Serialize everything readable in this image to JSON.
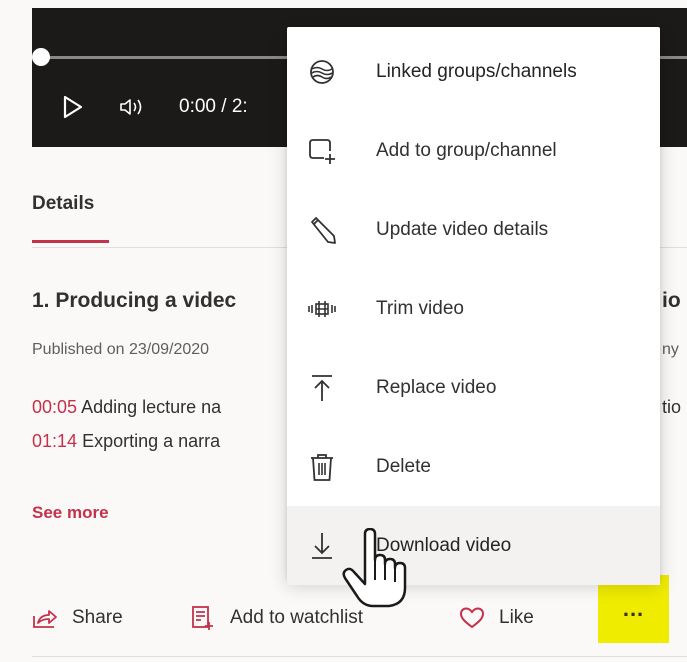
{
  "player": {
    "time": "0:00 / 2:"
  },
  "tabs": {
    "details": "Details"
  },
  "video": {
    "title": "1. Producing a videc",
    "title_tail": "io",
    "published": "Published on 23/09/2020",
    "published_tail": "ny",
    "chapters": [
      {
        "time": "00:05",
        "text": "Adding lecture na",
        "tail": "tio"
      },
      {
        "time": "01:14",
        "text": "Exporting a narra",
        "tail": ""
      }
    ],
    "see_more": "See more"
  },
  "actions": {
    "share": "Share",
    "watchlist": "Add to watchlist",
    "like": "Like",
    "more": "..."
  },
  "menu": {
    "items": [
      {
        "label": "Linked groups/channels",
        "icon": "linked-groups-icon"
      },
      {
        "label": "Add to group/channel",
        "icon": "add-to-group-icon"
      },
      {
        "label": "Update video details",
        "icon": "pencil-icon"
      },
      {
        "label": "Trim video",
        "icon": "trim-icon"
      },
      {
        "label": "Replace video",
        "icon": "replace-upload-icon"
      },
      {
        "label": "Delete",
        "icon": "trash-icon"
      },
      {
        "label": "Download video",
        "icon": "download-icon"
      }
    ]
  },
  "colors": {
    "accent": "#c4314b",
    "highlight": "#f0ec00",
    "player_bg": "#1b1a19"
  }
}
